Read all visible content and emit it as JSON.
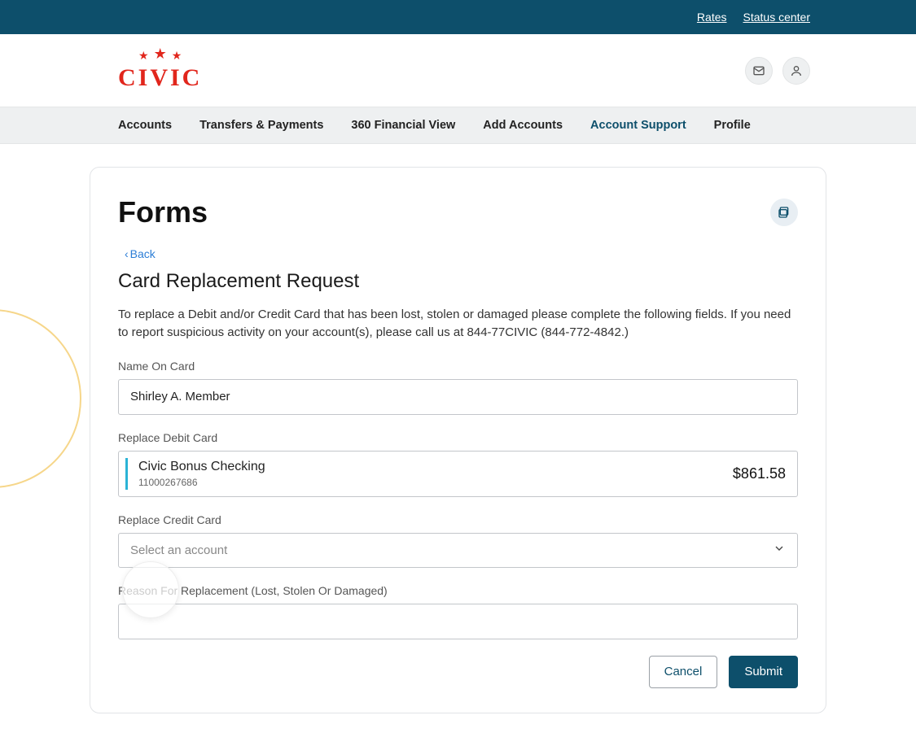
{
  "topbar": {
    "rates": "Rates",
    "status_center": "Status center"
  },
  "nav": {
    "items": [
      "Accounts",
      "Transfers & Payments",
      "360 Financial View",
      "Add Accounts",
      "Account Support",
      "Profile"
    ],
    "active_index": 4
  },
  "page": {
    "title": "Forms",
    "back_label": "Back"
  },
  "form": {
    "heading": "Card Replacement Request",
    "description": "To replace a Debit and/or Credit Card that has been lost, stolen or damaged please complete the following fields. If you need to report suspicious activity on your account(s), please call us at 844-77CIVIC (844-772-4842.)",
    "name_label": "Name On Card",
    "name_value": "Shirley A. Member",
    "debit_label": "Replace Debit Card",
    "debit_account": {
      "name": "Civic Bonus Checking",
      "number": "11000267686",
      "balance": "$861.58"
    },
    "credit_label": "Replace Credit Card",
    "credit_placeholder": "Select an account",
    "reason_label": "Reason For Replacement (Lost, Stolen Or Damaged)",
    "reason_value": "",
    "cancel": "Cancel",
    "submit": "Submit"
  }
}
